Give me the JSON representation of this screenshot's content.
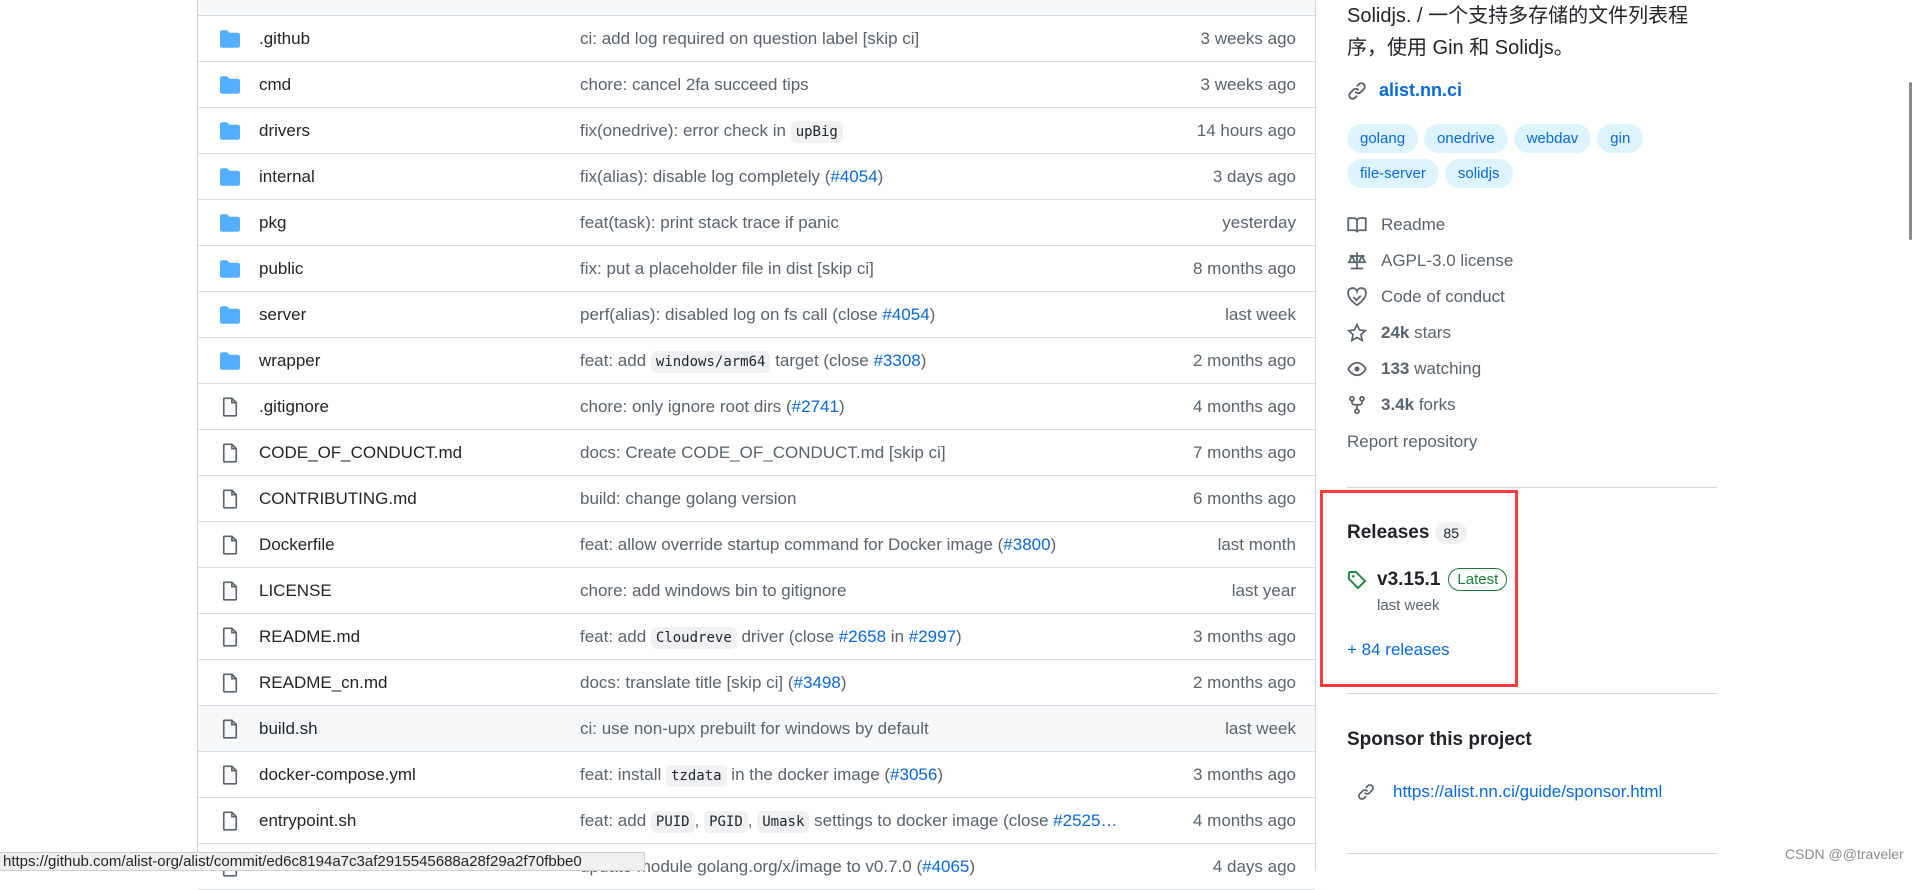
{
  "files": [
    {
      "name": ".github",
      "type": "folder",
      "date": "3 weeks ago",
      "msg": [
        {
          "t": "ci: add log required on question label [skip ci]"
        }
      ]
    },
    {
      "name": "cmd",
      "type": "folder",
      "date": "3 weeks ago",
      "msg": [
        {
          "t": "chore: cancel 2fa succeed tips"
        }
      ]
    },
    {
      "name": "drivers",
      "type": "folder",
      "date": "14 hours ago",
      "msg": [
        {
          "t": "fix(onedrive): error check in "
        },
        {
          "t": "upBig",
          "k": "code"
        }
      ]
    },
    {
      "name": "internal",
      "type": "folder",
      "date": "3 days ago",
      "msg": [
        {
          "t": "fix(alias): disable log completely ("
        },
        {
          "t": "#4054",
          "k": "link"
        },
        {
          "t": ")"
        }
      ]
    },
    {
      "name": "pkg",
      "type": "folder",
      "date": "yesterday",
      "msg": [
        {
          "t": "feat(task): print stack trace if panic"
        }
      ]
    },
    {
      "name": "public",
      "type": "folder",
      "date": "8 months ago",
      "msg": [
        {
          "t": "fix: put a placeholder file in dist [skip ci]"
        }
      ]
    },
    {
      "name": "server",
      "type": "folder",
      "date": "last week",
      "msg": [
        {
          "t": "perf(alias): disabled log on fs call (close "
        },
        {
          "t": "#4054",
          "k": "link"
        },
        {
          "t": ")"
        }
      ]
    },
    {
      "name": "wrapper",
      "type": "folder",
      "date": "2 months ago",
      "msg": [
        {
          "t": "feat: add "
        },
        {
          "t": "windows/arm64",
          "k": "code"
        },
        {
          "t": " target (close "
        },
        {
          "t": "#3308",
          "k": "link"
        },
        {
          "t": ")"
        }
      ]
    },
    {
      "name": ".gitignore",
      "type": "file",
      "date": "4 months ago",
      "msg": [
        {
          "t": "chore: only ignore root dirs ("
        },
        {
          "t": "#2741",
          "k": "link"
        },
        {
          "t": ")"
        }
      ]
    },
    {
      "name": "CODE_OF_CONDUCT.md",
      "type": "file",
      "date": "7 months ago",
      "msg": [
        {
          "t": "docs: Create CODE_OF_CONDUCT.md [skip ci]"
        }
      ]
    },
    {
      "name": "CONTRIBUTING.md",
      "type": "file",
      "date": "6 months ago",
      "msg": [
        {
          "t": "build: change golang version"
        }
      ]
    },
    {
      "name": "Dockerfile",
      "type": "file",
      "date": "last month",
      "msg": [
        {
          "t": "feat: allow override startup command for Docker image ("
        },
        {
          "t": "#3800",
          "k": "link"
        },
        {
          "t": ")"
        }
      ]
    },
    {
      "name": "LICENSE",
      "type": "file",
      "date": "last year",
      "msg": [
        {
          "t": "chore: add windows bin to gitignore"
        }
      ]
    },
    {
      "name": "README.md",
      "type": "file",
      "date": "3 months ago",
      "msg": [
        {
          "t": "feat: add "
        },
        {
          "t": "Cloudreve",
          "k": "code"
        },
        {
          "t": " driver (close "
        },
        {
          "t": "#2658",
          "k": "link"
        },
        {
          "t": " in "
        },
        {
          "t": "#2997",
          "k": "link"
        },
        {
          "t": ")"
        }
      ]
    },
    {
      "name": "README_cn.md",
      "type": "file",
      "date": "2 months ago",
      "msg": [
        {
          "t": "docs: translate title [skip ci] ("
        },
        {
          "t": "#3498",
          "k": "link"
        },
        {
          "t": ")"
        }
      ]
    },
    {
      "name": "build.sh",
      "type": "file",
      "date": "last week",
      "hover": true,
      "msg": [
        {
          "t": "ci: use non-upx prebuilt for windows by default"
        }
      ]
    },
    {
      "name": "docker-compose.yml",
      "type": "file",
      "date": "3 months ago",
      "msg": [
        {
          "t": "feat: install "
        },
        {
          "t": "tzdata",
          "k": "code"
        },
        {
          "t": " in the docker image ("
        },
        {
          "t": "#3056",
          "k": "link"
        },
        {
          "t": ")"
        }
      ]
    },
    {
      "name": "entrypoint.sh",
      "type": "file",
      "date": "4 months ago",
      "msg": [
        {
          "t": "feat: add "
        },
        {
          "t": "PUID",
          "k": "code"
        },
        {
          "t": ", "
        },
        {
          "t": "PGID",
          "k": "code"
        },
        {
          "t": ", "
        },
        {
          "t": "Umask",
          "k": "code"
        },
        {
          "t": " settings to docker image (close "
        },
        {
          "t": "#2525…",
          "k": "link"
        }
      ]
    },
    {
      "name": "",
      "type": "file",
      "date": "4 days ago",
      "msg": [
        {
          "t": "update module golang.org/x/image to v0.7.0 ("
        },
        {
          "t": "#4065",
          "k": "link"
        },
        {
          "t": ")"
        }
      ]
    }
  ],
  "sidebar": {
    "description": "Solidjs. / 一个支持多存储的文件列表程序，使用 Gin 和 Solidjs。",
    "homepage": "alist.nn.ci",
    "topics": [
      "golang",
      "onedrive",
      "webdav",
      "gin",
      "file-server",
      "solidjs"
    ],
    "readme": "Readme",
    "license": "AGPL-3.0 license",
    "conduct": "Code of conduct",
    "stars_count": "24k",
    "stars_label": "stars",
    "watching_count": "133",
    "watching_label": "watching",
    "forks_count": "3.4k",
    "forks_label": "forks",
    "report": "Report repository",
    "releases": {
      "title": "Releases",
      "count": "85",
      "version": "v3.15.1",
      "badge": "Latest",
      "date": "last week",
      "more": "+ 84 releases"
    },
    "sponsor": {
      "title": "Sponsor this project",
      "link": "https://alist.nn.ci/guide/sponsor.html"
    }
  },
  "status_url": "https://github.com/alist-org/alist/commit/ed6c8194a7c3af2915545688a28f29a2f70fbbe0",
  "watermark": "CSDN @@traveler",
  "colors": {
    "accent": "#0969da",
    "folder": "#54aeff",
    "latest": "#1a7f37",
    "highlight_box": "#ff3b3b"
  }
}
